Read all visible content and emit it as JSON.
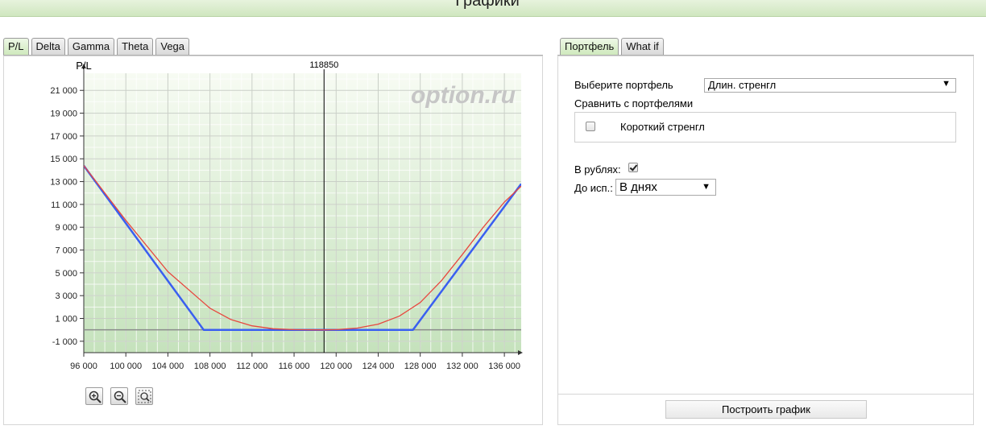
{
  "header": {
    "title": "Графики"
  },
  "left_tabs": [
    "P/L",
    "Delta",
    "Gamma",
    "Theta",
    "Vega"
  ],
  "right_tabs": [
    "Портфель",
    "What if"
  ],
  "colors": {
    "portfolio_line": "#3a5ff0",
    "current_line": "#e8473f",
    "zero_line": "#8a8a8a",
    "marker_line": "#000000",
    "watermark": "#c6c6c6"
  },
  "watermark": "option.ru",
  "chart_data": {
    "type": "line",
    "ylabel": "P/L",
    "marker": {
      "x": 118850,
      "label": "118850"
    },
    "xlim": [
      96000,
      137600
    ],
    "ylim": [
      -2000,
      22500
    ],
    "x_ticks": [
      96000,
      100000,
      104000,
      108000,
      112000,
      116000,
      120000,
      124000,
      128000,
      132000,
      136000
    ],
    "x_tick_labels": [
      "96 000",
      "100 000",
      "104 000",
      "108 000",
      "112 000",
      "116 000",
      "120 000",
      "124 000",
      "128 000",
      "132 000",
      "136 000"
    ],
    "y_ticks": [
      -1000,
      1000,
      3000,
      5000,
      7000,
      9000,
      11000,
      13000,
      15000,
      17000,
      19000,
      21000
    ],
    "y_tick_labels": [
      "-1 000",
      "1 000",
      "3 000",
      "5 000",
      "7 000",
      "9 000",
      "11 000",
      "13 000",
      "15 000",
      "17 000",
      "19 000",
      "21 000"
    ],
    "grid": true,
    "series": [
      {
        "color": "#3a5ff0",
        "x": [
          96000,
          107400,
          127300,
          137600
        ],
        "y": [
          14400,
          0,
          0,
          12800
        ]
      },
      {
        "color": "#e8473f",
        "x": [
          96000,
          100000,
          104000,
          108000,
          110000,
          112000,
          114000,
          116000,
          118000,
          119000,
          120000,
          122000,
          124000,
          126000,
          128000,
          130000,
          132000,
          134000,
          136000,
          137600
        ],
        "y": [
          14400,
          9600,
          5100,
          1900,
          900,
          350,
          100,
          20,
          0,
          0,
          20,
          150,
          500,
          1200,
          2400,
          4300,
          6600,
          9000,
          11200,
          12600
        ]
      }
    ]
  },
  "zoom": {
    "in": "zoom-in",
    "out": "zoom-out",
    "fit": "zoom-fit"
  },
  "portfolio": {
    "select_label": "Выберите портфель",
    "selected": "Длин. стренгл",
    "compare_label": "Сравнить с портфелями",
    "compare_item": "Короткий стренгл",
    "rubles_label": "В рублях:",
    "expiry_label": "До исп.:",
    "expiry_value": "В днях",
    "build_button": "Построить график"
  }
}
